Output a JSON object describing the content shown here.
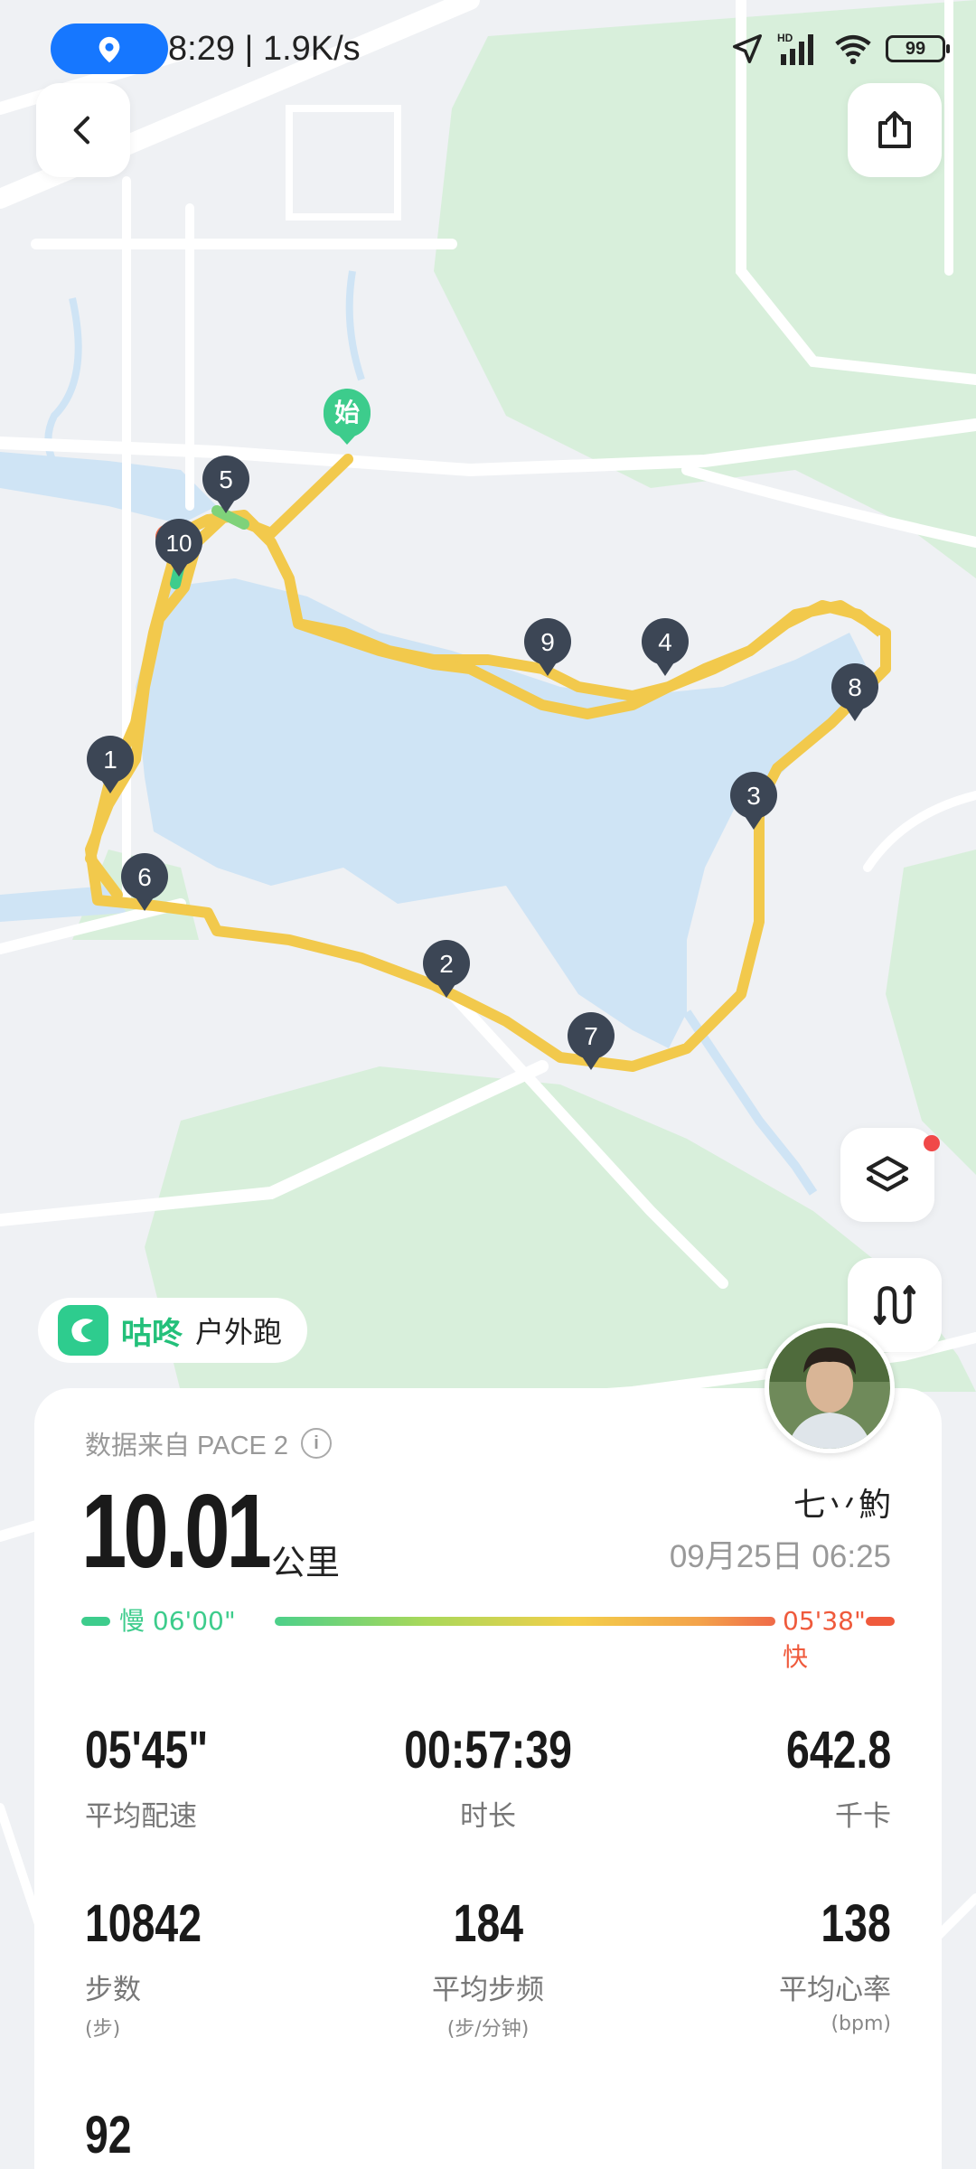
{
  "status_bar": {
    "time_speed": "8:29 | 1.9K/s",
    "battery": "99",
    "hd": "HD"
  },
  "map": {
    "start_marker": "始",
    "km_markers": [
      "1",
      "2",
      "3",
      "4",
      "5",
      "6",
      "7",
      "8",
      "9",
      "10"
    ],
    "icons": [
      "location-icon",
      "back-icon",
      "share-icon",
      "layers-icon",
      "route-icon"
    ]
  },
  "sport": {
    "brand": "咕咚",
    "type": "户外跑"
  },
  "card": {
    "source": "数据来自 PACE 2",
    "distance": "10.01",
    "distance_unit": "公里",
    "username": "七丷魡",
    "datetime": "09月25日 06:25",
    "pace_slow": "慢 06'00\"",
    "pace_fast": "05'38\" 快",
    "stats": {
      "avg_pace": {
        "value": "05'45\"",
        "label": "平均配速"
      },
      "duration": {
        "value": "00:57:39",
        "label": "时长"
      },
      "calories": {
        "value": "642.8",
        "label": "千卡"
      },
      "steps": {
        "value": "10842",
        "label": "步数",
        "sub": "(步)"
      },
      "cadence": {
        "value": "184",
        "label": "平均步频",
        "sub": "(步/分钟)"
      },
      "heart_rate": {
        "value": "138",
        "label": "平均心率",
        "sub": "(bpm)"
      },
      "extra": {
        "value": "92"
      }
    }
  },
  "colors": {
    "route": "#f2c94c",
    "water": "#cfe4f5",
    "green": "#d9eedb",
    "accent": "#23c07a",
    "marker": "#3c4655"
  }
}
